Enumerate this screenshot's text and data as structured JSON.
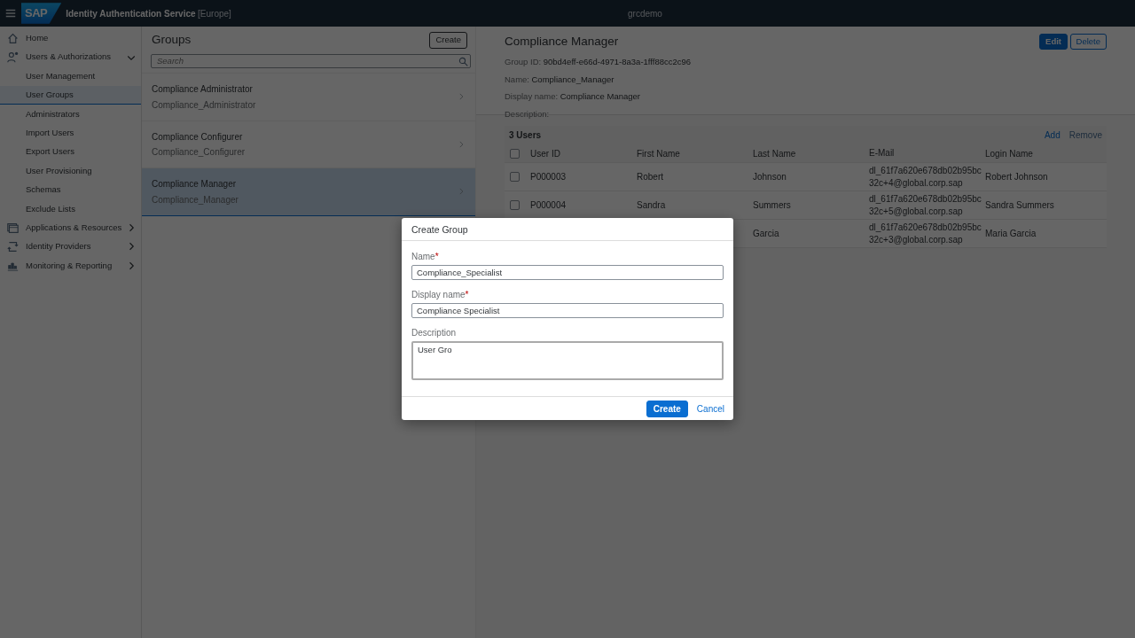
{
  "shell": {
    "logo": "SAP",
    "title": "Identity Authentication Service",
    "region": "[Europe]",
    "tenant": "grcdemo"
  },
  "sidebar": {
    "items": [
      {
        "label": "Home",
        "selected": false
      },
      {
        "label": "Users & Authorizations",
        "selected": false,
        "expanded": true,
        "children": [
          {
            "label": "User Management",
            "selected": false
          },
          {
            "label": "User Groups",
            "selected": true
          },
          {
            "label": "Administrators",
            "selected": false
          },
          {
            "label": "Import Users",
            "selected": false
          },
          {
            "label": "Export Users",
            "selected": false
          },
          {
            "label": "User Provisioning",
            "selected": false
          },
          {
            "label": "Schemas",
            "selected": false
          },
          {
            "label": "Exclude Lists",
            "selected": false
          }
        ]
      },
      {
        "label": "Applications & Resources",
        "selected": false,
        "expanded": false
      },
      {
        "label": "Identity Providers",
        "selected": false,
        "expanded": false
      },
      {
        "label": "Monitoring & Reporting",
        "selected": false,
        "expanded": false
      }
    ]
  },
  "groups": {
    "title": "Groups",
    "create_button": "Create",
    "search": {
      "placeholder": "Search"
    },
    "items": [
      {
        "title": "Compliance Administrator",
        "subtitle": "Compliance_Administrator",
        "selected": false
      },
      {
        "title": "Compliance Configurer",
        "subtitle": "Compliance_Configurer",
        "selected": false
      },
      {
        "title": "Compliance Manager",
        "subtitle": "Compliance_Manager",
        "selected": true
      }
    ]
  },
  "detail": {
    "title": "Compliance Manager",
    "buttons": [
      {
        "label": "Edit",
        "kind": "primary"
      },
      {
        "label": "Delete",
        "kind": "secondary"
      }
    ],
    "fields": [
      {
        "label": "Group ID:",
        "value": "90bd4eff-e66d-4971-8a3a-1fff88cc2c96"
      },
      {
        "label": "Name:",
        "value": "Compliance_Manager"
      },
      {
        "label": "Display name:",
        "value": "Compliance Manager"
      },
      {
        "label": "Description:"
      }
    ],
    "table": {
      "count": "3 Users",
      "actions": [
        {
          "label": "Add",
          "disabled": false
        },
        {
          "label": "Remove",
          "disabled": true
        }
      ],
      "columns": [
        "User ID",
        "First Name",
        "Last Name",
        "E-Mail",
        "Login Name"
      ],
      "header_checked": false,
      "rows": [
        {
          "checked": false,
          "cells": [
            "P000003",
            "Robert",
            "Johnson",
            "dl_61f7a620e678db02b95bc32c+4@global.corp.sap",
            "Robert Johnson"
          ]
        },
        {
          "checked": false,
          "cells": [
            "P000004",
            "Sandra",
            "Summers",
            "dl_61f7a620e678db02b95bc32c+5@global.corp.sap",
            "Sandra Summers"
          ]
        },
        {
          "cells": [
            null,
            null,
            "Garcia",
            "dl_61f7a620e678db02b95bc32c+3@global.corp.sap",
            "Maria Garcia"
          ]
        }
      ]
    }
  },
  "dialog": {
    "title": "Create Group",
    "fields": [
      {
        "label": "Name",
        "required_mark": "*",
        "kind": "input",
        "value": "Compliance_Specialist",
        "focused": false
      },
      {
        "label": "Display name",
        "required_mark": "*",
        "kind": "input",
        "value": "Compliance Specialist",
        "focused": false
      },
      {
        "label": "Description",
        "kind": "textarea",
        "value": "User Gro",
        "focused": true
      }
    ],
    "buttons": [
      {
        "label": "Create",
        "kind": "primary"
      },
      {
        "label": "Cancel",
        "kind": "link"
      }
    ]
  }
}
